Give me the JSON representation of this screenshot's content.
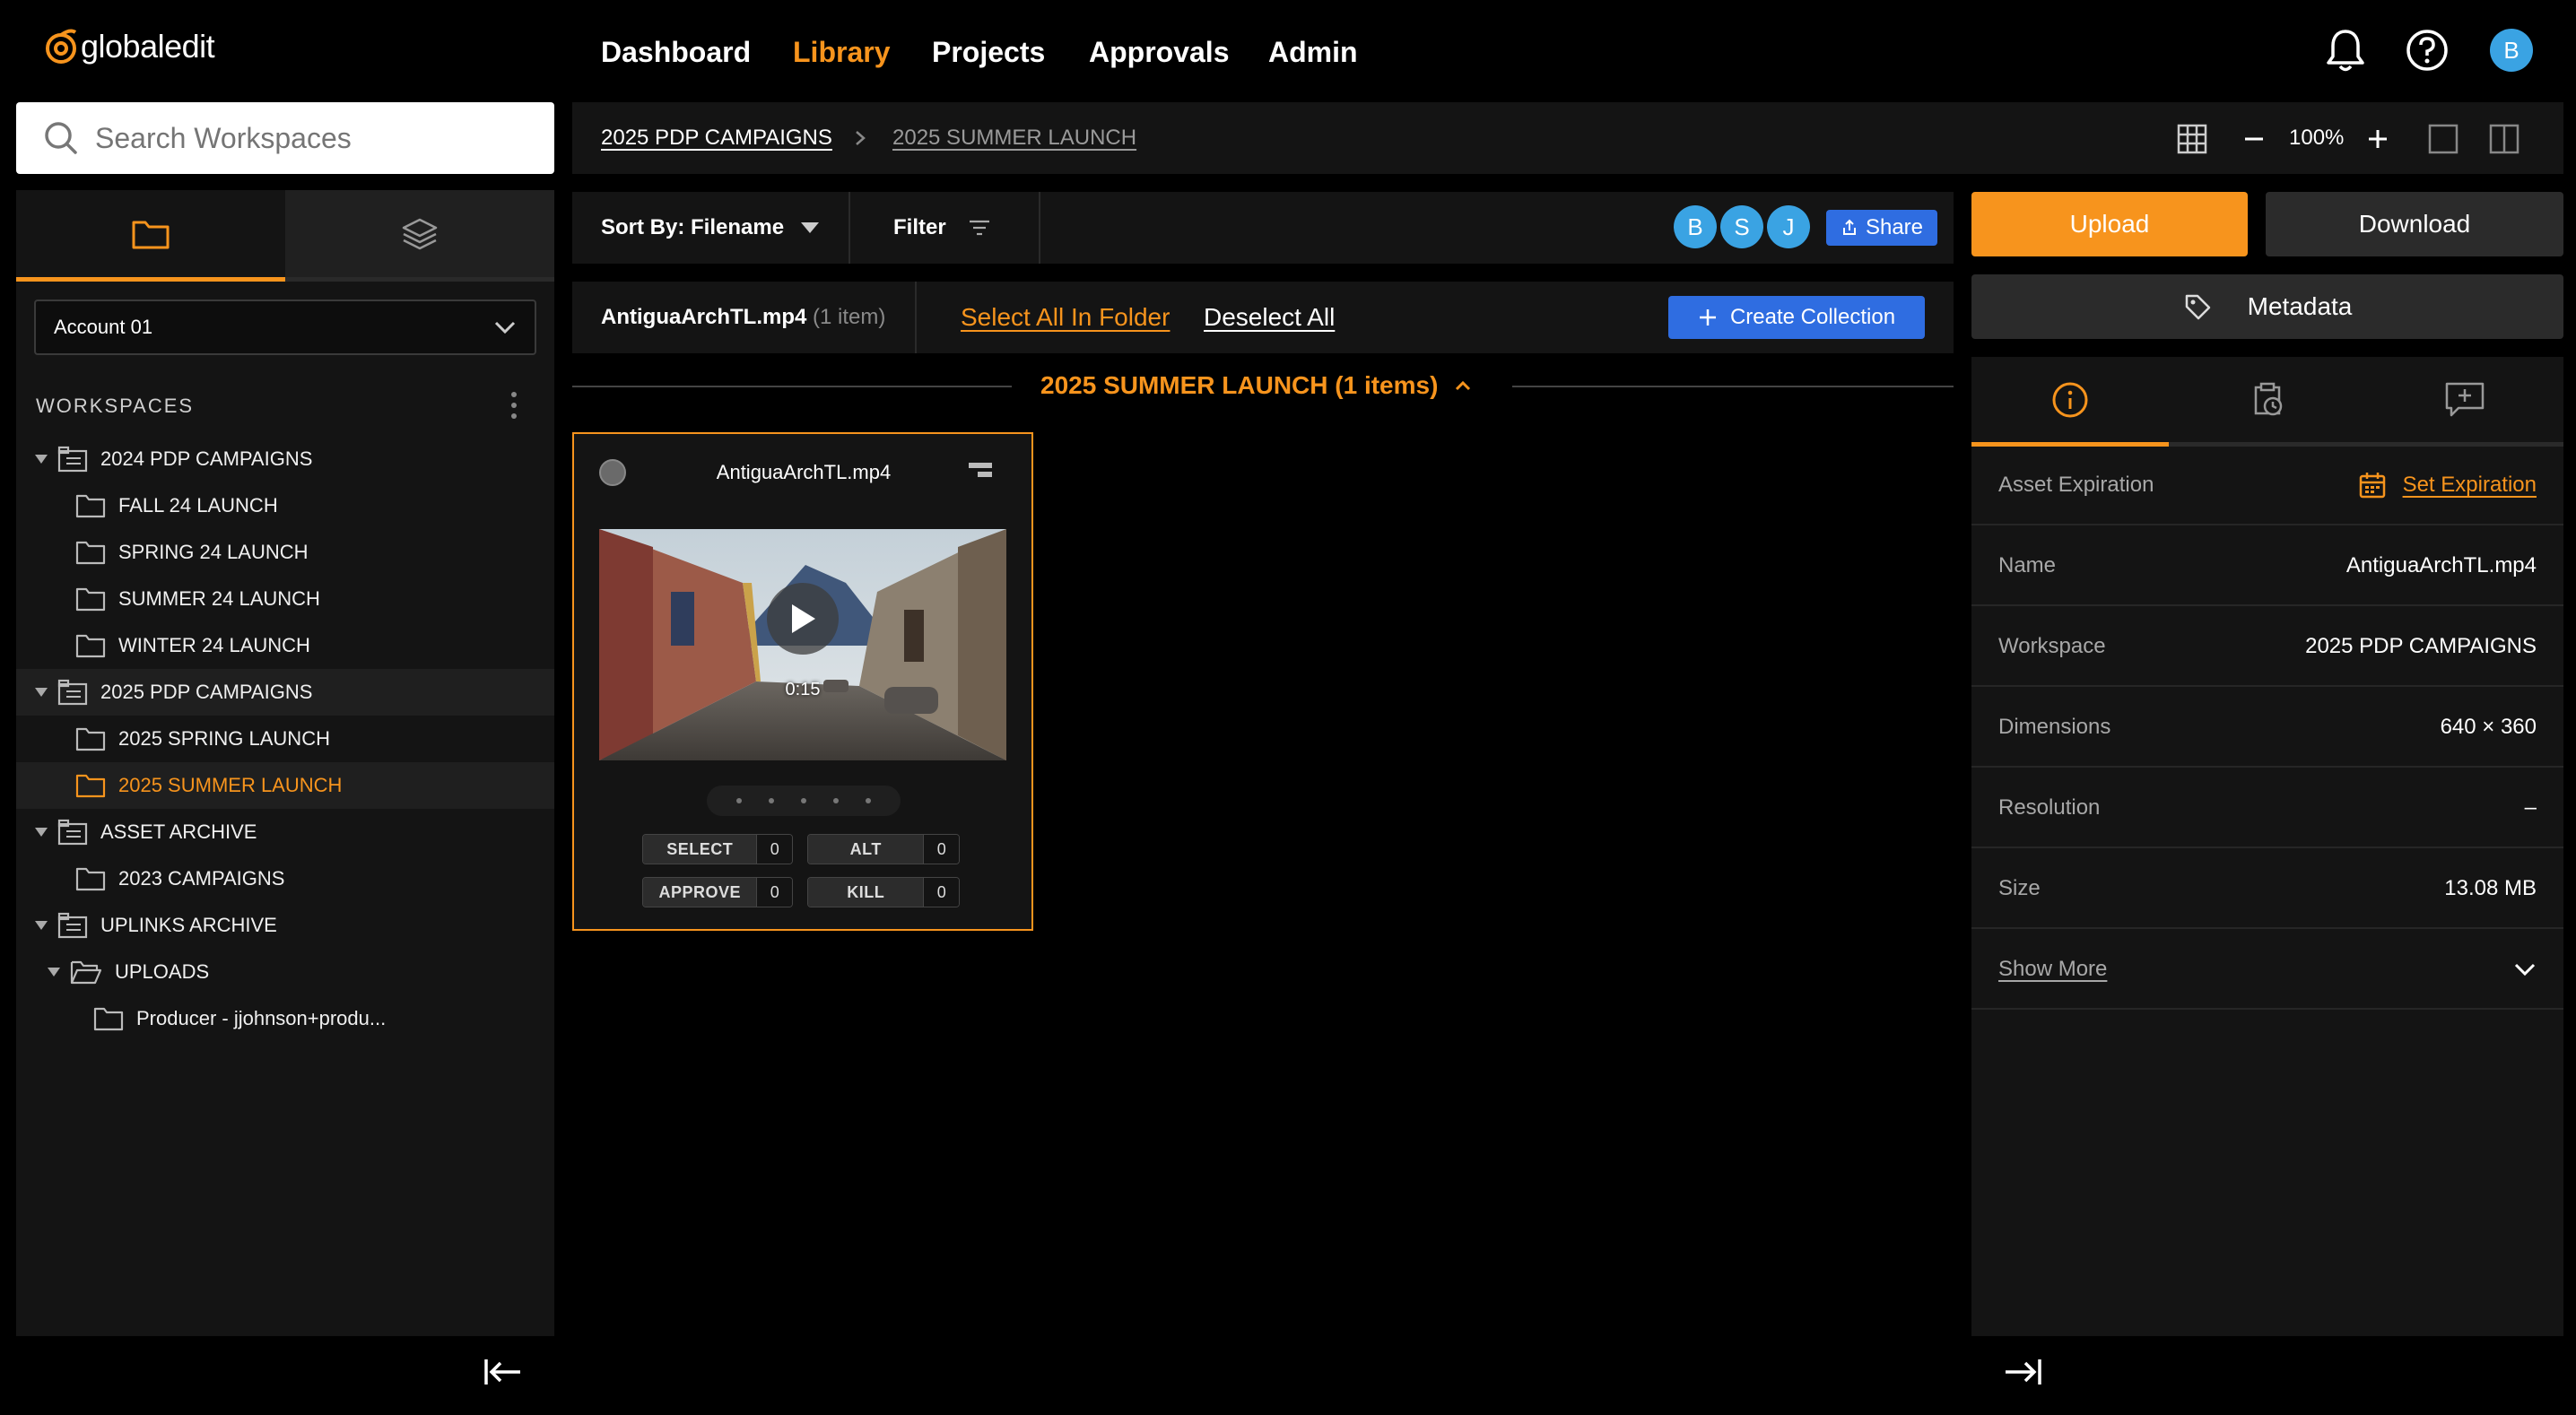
{
  "brand": {
    "name": "globaledit"
  },
  "nav": {
    "dashboard": "Dashboard",
    "library": "Library",
    "projects": "Projects",
    "approvals": "Approvals",
    "admin": "Admin"
  },
  "user": {
    "initial": "B"
  },
  "search": {
    "placeholder": "Search Workspaces"
  },
  "account": {
    "selected": "Account 01"
  },
  "workspaces": {
    "heading": "WORKSPACES",
    "tree": [
      {
        "label": "2024 PDP CAMPAIGNS"
      },
      {
        "label": "FALL 24 LAUNCH"
      },
      {
        "label": "SPRING 24 LAUNCH"
      },
      {
        "label": "SUMMER 24 LAUNCH"
      },
      {
        "label": "WINTER 24 LAUNCH"
      },
      {
        "label": "2025 PDP CAMPAIGNS"
      },
      {
        "label": "2025 SPRING LAUNCH"
      },
      {
        "label": "2025 SUMMER LAUNCH"
      },
      {
        "label": "ASSET ARCHIVE"
      },
      {
        "label": "2023 CAMPAIGNS"
      },
      {
        "label": "UPLINKS ARCHIVE"
      },
      {
        "label": "UPLOADS"
      },
      {
        "label": "Producer - jjohnson+produ..."
      }
    ]
  },
  "breadcrumb": {
    "parent": "2025 PDP CAMPAIGNS",
    "current": "2025 SUMMER LAUNCH"
  },
  "view": {
    "zoom": "100%"
  },
  "toolbar": {
    "sort_label": "Sort By: Filename",
    "filter_label": "Filter",
    "collaborators": [
      "B",
      "S",
      "J"
    ],
    "share_label": "Share"
  },
  "selection": {
    "filename": "AntiguaArchTL.mp4",
    "count": "(1 item)",
    "select_all": "Select All In Folder",
    "deselect_all": "Deselect All",
    "create_collection": "Create Collection"
  },
  "group": {
    "title": "2025 SUMMER LAUNCH (1 items)"
  },
  "asset": {
    "filename": "AntiguaArchTL.mp4",
    "duration": "0:15",
    "votes": [
      {
        "label": "SELECT",
        "count": "0"
      },
      {
        "label": "ALT",
        "count": "0"
      },
      {
        "label": "APPROVE",
        "count": "0"
      },
      {
        "label": "KILL",
        "count": "0"
      }
    ]
  },
  "actions": {
    "upload": "Upload",
    "download": "Download",
    "metadata": "Metadata"
  },
  "details": {
    "expiration_label": "Asset Expiration",
    "set_expiration": "Set Expiration",
    "rows": [
      {
        "key": "Name",
        "value": "AntiguaArchTL.mp4"
      },
      {
        "key": "Workspace",
        "value": "2025 PDP CAMPAIGNS"
      },
      {
        "key": "Dimensions",
        "value": "640 × 360"
      },
      {
        "key": "Resolution",
        "value": "–"
      },
      {
        "key": "Size",
        "value": "13.08 MB"
      }
    ],
    "show_more": "Show More"
  },
  "colors": {
    "accent": "#f7941d",
    "primary_blue": "#2f6de1",
    "avatar_blue": "#3aa3e3"
  }
}
